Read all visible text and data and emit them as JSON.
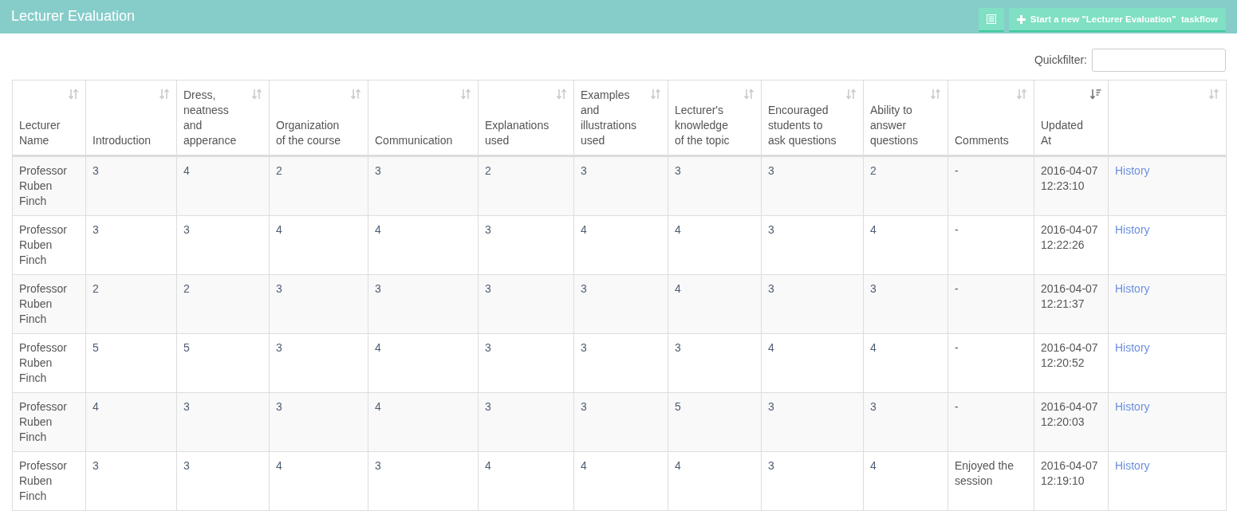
{
  "header": {
    "title": "Lecturer Evaluation",
    "new_button": {
      "label": "Start a new \"Lecturer Evaluation\"  taskflow"
    }
  },
  "quickfilter": {
    "label": "Quickfilter:"
  },
  "table": {
    "columns": [
      {
        "label": "Lecturer Name",
        "sorted": false
      },
      {
        "label": "Introduction",
        "sorted": false
      },
      {
        "label": "Dress, neatness and apperance",
        "sorted": false
      },
      {
        "label": "Organization of the course",
        "sorted": false
      },
      {
        "label": "Communication",
        "sorted": false
      },
      {
        "label": "Explanations used",
        "sorted": false
      },
      {
        "label": "Examples and illustrations used",
        "sorted": false
      },
      {
        "label": "Lecturer's knowledge of the topic",
        "sorted": false
      },
      {
        "label": "Encouraged students to ask questions",
        "sorted": false
      },
      {
        "label": "Ability to answer questions",
        "sorted": false
      },
      {
        "label": "Comments",
        "sorted": false
      },
      {
        "label": "Updated At",
        "sorted": true
      },
      {
        "sorted": false
      }
    ],
    "rows": [
      {
        "cells": [
          "Professor Ruben Finch",
          "3",
          "4",
          "2",
          "3",
          "2",
          "3",
          "3",
          "3",
          "2",
          "-",
          "2016-04-07 12:23:10"
        ],
        "link": "History"
      },
      {
        "cells": [
          "Professor Ruben Finch",
          "3",
          "3",
          "4",
          "4",
          "3",
          "4",
          "4",
          "3",
          "4",
          "-",
          "2016-04-07 12:22:26"
        ],
        "link": "History"
      },
      {
        "cells": [
          "Professor Ruben Finch",
          "2",
          "2",
          "3",
          "3",
          "3",
          "3",
          "4",
          "3",
          "3",
          "-",
          "2016-04-07 12:21:37"
        ],
        "link": "History"
      },
      {
        "cells": [
          "Professor Ruben Finch",
          "5",
          "5",
          "3",
          "4",
          "3",
          "3",
          "3",
          "4",
          "4",
          "-",
          "2016-04-07 12:20:52"
        ],
        "link": "History"
      },
      {
        "cells": [
          "Professor Ruben Finch",
          "4",
          "3",
          "3",
          "4",
          "3",
          "3",
          "5",
          "3",
          "3",
          "-",
          "2016-04-07 12:20:03"
        ],
        "link": "History"
      },
      {
        "cells": [
          "Professor Ruben Finch",
          "3",
          "3",
          "4",
          "3",
          "4",
          "4",
          "4",
          "3",
          "4",
          "Enjoyed the session",
          "2016-04-07 12:19:10"
        ],
        "link": "History"
      }
    ]
  }
}
